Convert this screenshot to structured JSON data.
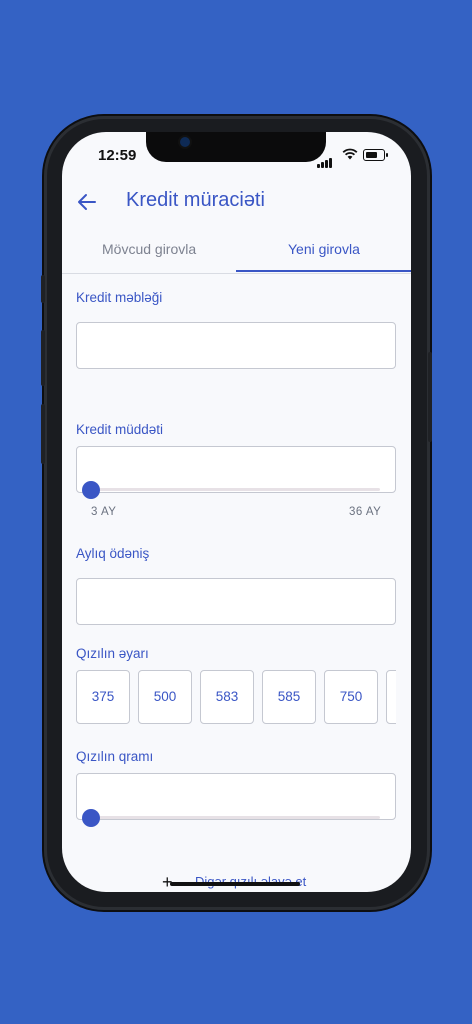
{
  "status_bar": {
    "time": "12:59"
  },
  "header": {
    "back_icon": "arrow-left-icon",
    "title": "Kredit müraciəti"
  },
  "tabs": [
    {
      "label": "Mövcud girovla",
      "active": false
    },
    {
      "label": "Yeni girovla",
      "active": true
    }
  ],
  "form": {
    "loan_amount": {
      "label": "Kredit  məbləği",
      "value": ""
    },
    "loan_term": {
      "label": "Kredit  müddəti",
      "min_label": "3 AY",
      "max_label": "36 AY",
      "value_fraction": 0
    },
    "monthly_payment": {
      "label": "Aylıq ödəniş",
      "value": ""
    },
    "gold_purity": {
      "label": "Qızılın əyarı",
      "options": [
        "375",
        "500",
        "583",
        "585",
        "750"
      ]
    },
    "gold_weight": {
      "label": "Qızılın qramı",
      "value_fraction": 0
    },
    "add_gold_label": "Digər qızılı əlavə et"
  },
  "colors": {
    "accent": "#3a56c5",
    "background": "#3462c4"
  }
}
